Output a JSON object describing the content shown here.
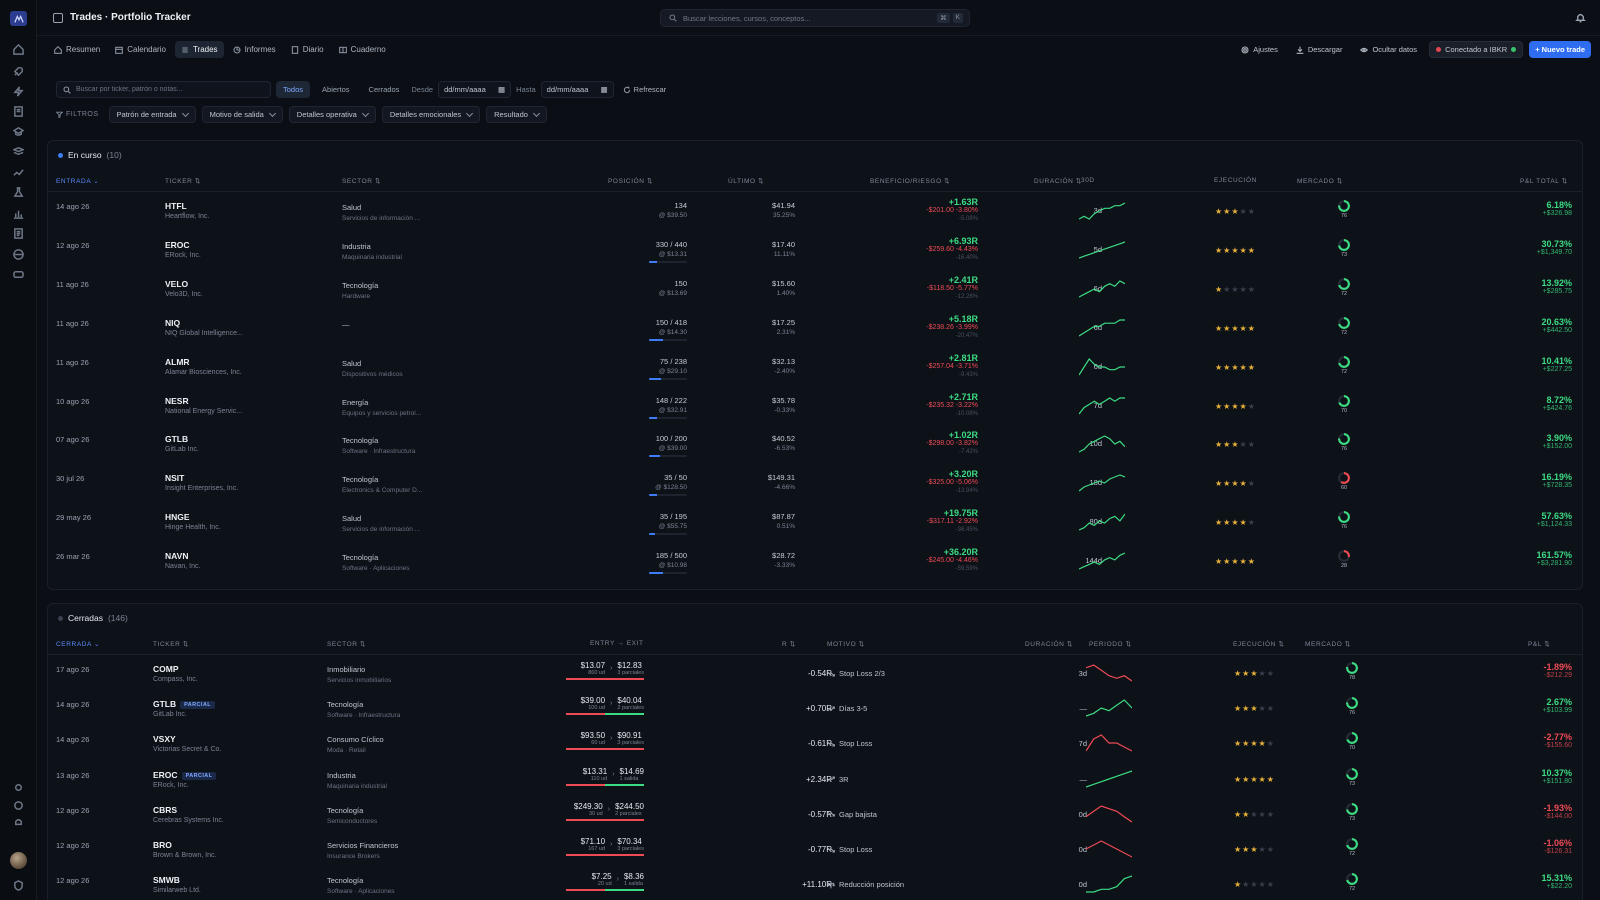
{
  "app": {
    "title": "Trades · Portfolio Tracker"
  },
  "search": {
    "placeholder": "Buscar lecciones, cursos, conceptos...",
    "k1": "⌘",
    "k2": "K"
  },
  "tabs": [
    {
      "label": "Resumen",
      "icon": "home-icon"
    },
    {
      "label": "Calendario",
      "icon": "calendar-icon"
    },
    {
      "label": "Trades",
      "icon": "list-icon",
      "active": true
    },
    {
      "label": "Informes",
      "icon": "chart-icon"
    },
    {
      "label": "Diario",
      "icon": "book-icon"
    },
    {
      "label": "Cuaderno",
      "icon": "notebook-icon"
    }
  ],
  "actions": {
    "ajustes": "Ajustes",
    "descargar": "Descargar",
    "ocultar": "Ocultar datos",
    "ibkr": "Conectado a IBKR",
    "nuevo": "+ Nuevo trade"
  },
  "filters": {
    "search_placeholder": "Buscar por ticker, patrón o notas...",
    "segments": [
      "Todos",
      "Abiertos",
      "Cerrados"
    ],
    "desde": "Desde",
    "hasta": "Hasta",
    "date_placeholder": "dd/mm/aaaa",
    "refresh": "Refrescar",
    "filtros": "FILTROS",
    "dropdowns": [
      "Patrón de entrada",
      "Motivo de salida",
      "Detalles operativa",
      "Detalles emocionales",
      "Resultado"
    ]
  },
  "open": {
    "title": "En curso",
    "count": "(10)",
    "headers": {
      "entrada": "ENTRADA",
      "ticker": "TICKER",
      "sector": "SECTOR",
      "posicion": "POSICIÓN",
      "ultimo": "ÚLTIMO",
      "br": "BENEFICIO/RIESGO",
      "duracion": "DURACIÓN",
      "d30": "30D",
      "ejecucion": "EJECUCIÓN",
      "mercado": "MERCADO",
      "pnl": "P&L TOTAL"
    },
    "rows": [
      {
        "date": "14 ago 26",
        "ticker": "HTFL",
        "name": "Heartflow, Inc.",
        "sector": "Salud",
        "industry": "Servicios de información ...",
        "pos": "134",
        "avg": "@ $39.50",
        "fill": 0,
        "last": "$41.94",
        "chg": "35.25%",
        "r": "+1.63R",
        "risk": "-$201.00 -3.80%",
        "risk2": "-5.08%",
        "dur": "3d",
        "spark": [
          5,
          6,
          5,
          7,
          8,
          9,
          9,
          10,
          10,
          11
        ],
        "stars": 3,
        "mkt": 76,
        "mkt_color": "#3ddc84",
        "pnl": "6.18%",
        "pnl2": "+$326.98"
      },
      {
        "date": "12 ago 26",
        "ticker": "EROC",
        "name": "ERock, Inc.",
        "sector": "Industria",
        "industry": "Maquinaria industrial",
        "pos": "330 / 440",
        "avg": "@ $13.31",
        "fill": 0.2,
        "last": "$17.40",
        "chg": "11.11%",
        "r": "+6.93R",
        "risk": "-$259.60 -4.43%",
        "risk2": "-16.40%",
        "dur": "5d",
        "spark": [
          2,
          3,
          4,
          5,
          6,
          7,
          8,
          9,
          10,
          11
        ],
        "stars": 5,
        "mkt": 73,
        "mkt_color": "#3ddc84",
        "pnl": "30.73%",
        "pnl2": "+$1,349.70"
      },
      {
        "date": "11 ago 26",
        "ticker": "VELO",
        "name": "Velo3D, Inc.",
        "sector": "Tecnología",
        "industry": "Hardware",
        "pos": "150",
        "avg": "@ $13.69",
        "fill": 0,
        "last": "$15.60",
        "chg": "1.40%",
        "r": "+2.41R",
        "risk": "-$118.50 -5.77%",
        "risk2": "-12.28%",
        "dur": "6d",
        "spark": [
          4,
          5,
          6,
          7,
          6,
          8,
          9,
          8,
          10,
          9
        ],
        "stars": 1,
        "mkt": 72,
        "mkt_color": "#3ddc84",
        "pnl": "13.92%",
        "pnl2": "+$285.75"
      },
      {
        "date": "11 ago 26",
        "ticker": "NIQ",
        "name": "NIQ Global Intelligence...",
        "sector": "—",
        "industry": "",
        "pos": "150 / 418",
        "avg": "@ $14.30",
        "fill": 0.36,
        "last": "$17.25",
        "chg": "2.31%",
        "r": "+5.18R",
        "risk": "-$238.26 -3.99%",
        "risk2": "-20.47%",
        "dur": "6d",
        "spark": [
          4,
          5,
          6,
          7,
          7,
          8,
          8,
          8,
          9,
          9
        ],
        "stars": 5,
        "mkt": 72,
        "mkt_color": "#3ddc84",
        "pnl": "20.63%",
        "pnl2": "+$442.50"
      },
      {
        "date": "11 ago 26",
        "ticker": "ALMR",
        "name": "Alamar Biosciences, Inc.",
        "sector": "Salud",
        "industry": "Dispositivos médicos",
        "pos": "75 / 238",
        "avg": "@ $29.10",
        "fill": 0.32,
        "last": "$32.13",
        "chg": "-2.40%",
        "r": "+2.81R",
        "risk": "-$257.04 -3.71%",
        "risk2": "-9.43%",
        "dur": "6d",
        "spark": [
          3,
          6,
          9,
          7,
          6,
          6,
          5,
          5,
          6,
          6
        ],
        "stars": 5,
        "mkt": 72,
        "mkt_color": "#3ddc84",
        "pnl": "10.41%",
        "pnl2": "+$227.25"
      },
      {
        "date": "10 ago 26",
        "ticker": "NESR",
        "name": "National Energy Servic...",
        "sector": "Energía",
        "industry": "Equipos y servicios petrol...",
        "pos": "148 / 222",
        "avg": "@ $32.91",
        "fill": 0.2,
        "last": "$35.78",
        "chg": "-0.33%",
        "r": "+2.71R",
        "risk": "-$235.32 -3.22%",
        "risk2": "-10.08%",
        "dur": "7d",
        "spark": [
          4,
          6,
          7,
          8,
          7,
          8,
          9,
          8,
          9,
          9
        ],
        "stars": 4,
        "mkt": 70,
        "mkt_color": "#3ddc84",
        "pnl": "8.72%",
        "pnl2": "+$424.76"
      },
      {
        "date": "07 ago 26",
        "ticker": "GTLB",
        "name": "GitLab Inc.",
        "sector": "Tecnología",
        "industry": "Software · Infraestructura",
        "pos": "100 / 200",
        "avg": "@ $39.00",
        "fill": 0.3,
        "last": "$40.52",
        "chg": "-6.53%",
        "r": "+1.02R",
        "risk": "-$298.00 -3.82%",
        "risk2": "-7.42%",
        "dur": "10d",
        "spark": [
          3,
          4,
          6,
          7,
          8,
          9,
          8,
          6,
          7,
          5
        ],
        "stars": 3,
        "mkt": 76,
        "mkt_color": "#3ddc84",
        "pnl": "3.90%",
        "pnl2": "+$152.00"
      },
      {
        "date": "30 jul 26",
        "ticker": "NSIT",
        "name": "Insight Enterprises, Inc.",
        "sector": "Tecnología",
        "industry": "Electronics & Computer D...",
        "pos": "35 / 50",
        "avg": "@ $128.50",
        "fill": 0.22,
        "last": "$149.31",
        "chg": "-4.66%",
        "r": "+3.20R",
        "risk": "-$325.00 -5.06%",
        "risk2": "-13.94%",
        "dur": "18d",
        "spark": [
          3,
          5,
          6,
          7,
          8,
          7,
          9,
          10,
          11,
          10
        ],
        "stars": 4,
        "mkt": 60,
        "mkt_color": "#ef4b55",
        "pnl": "16.19%",
        "pnl2": "+$728.35"
      },
      {
        "date": "29 may 26",
        "ticker": "HNGE",
        "name": "Hinge Health, Inc.",
        "sector": "Salud",
        "industry": "Servicios de información ...",
        "pos": "35 / 195",
        "avg": "@ $55.75",
        "fill": 0.15,
        "last": "$87.87",
        "chg": "0.51%",
        "r": "+19.75R",
        "risk": "-$317.11 -2.92%",
        "risk2": "-36.45%",
        "dur": "80d",
        "spark": [
          3,
          4,
          6,
          5,
          7,
          6,
          8,
          9,
          7,
          10
        ],
        "stars": 4,
        "mkt": 76,
        "mkt_color": "#3ddc84",
        "pnl": "57.63%",
        "pnl2": "+$1,124.33"
      },
      {
        "date": "26 mar 26",
        "ticker": "NAVN",
        "name": "Navan, Inc.",
        "sector": "Tecnología",
        "industry": "Software · Aplicaciones",
        "pos": "185 / 500",
        "avg": "@ $10.98",
        "fill": 0.37,
        "last": "$28.72",
        "chg": "-3.33%",
        "r": "+36.20R",
        "risk": "-$245.00 -4.46%",
        "risk2": "-59.59%",
        "dur": "144d",
        "spark": [
          3,
          4,
          5,
          6,
          5,
          7,
          8,
          7,
          9,
          10
        ],
        "stars": 5,
        "mkt": 28,
        "mkt_color": "#ef4b55",
        "pnl": "161.57%",
        "pnl2": "+$3,281.90"
      }
    ]
  },
  "closed": {
    "title": "Cerradas",
    "count": "(146)",
    "headers": {
      "cerrada": "CERRADA",
      "ticker": "TICKER",
      "sector": "SECTOR",
      "ee": "ENTRY → EXIT",
      "r": "R",
      "motivo": "MOTIVO",
      "duracion": "DURACIÓN",
      "periodo": "PERIODO",
      "ejecucion": "EJECUCIÓN",
      "mercado": "MERCADO",
      "pnl": "P&L"
    },
    "rows": [
      {
        "date": "17 ago 26",
        "ticker": "COMP",
        "tag": "",
        "name": "Compass, Inc.",
        "sector": "Inmobiliario",
        "industry": "Servicios inmobiliarios",
        "entry": "$13.07",
        "entry_u": "860 ud",
        "exit": "$12.83",
        "exit_u": "3 parciales",
        "win": false,
        "r": "-0.54R",
        "motivo": "Stop Loss 2/3",
        "motivo_icon": "trend-down-icon",
        "dur": "3d",
        "spark": [
          8,
          9,
          7,
          5,
          4,
          5,
          3
        ],
        "stars": 3,
        "mkt": 78,
        "mkt_color": "#3ddc84",
        "pnl": "-1.89%",
        "pnl2": "-$212.29"
      },
      {
        "date": "14 ago 26",
        "ticker": "GTLB",
        "tag": "PARCIAL",
        "name": "GitLab Inc.",
        "sector": "Tecnología",
        "industry": "Software · Infraestructura",
        "entry": "$39.00",
        "entry_u": "100 ud",
        "exit": "$40.04",
        "exit_u": "2 parciales",
        "win": true,
        "r": "+0.70R",
        "motivo": "Días 3-5",
        "motivo_icon": "trend-up-icon",
        "dur": "—",
        "spark": [
          3,
          4,
          6,
          5,
          7,
          9,
          6
        ],
        "stars": 3,
        "mkt": 76,
        "mkt_color": "#3ddc84",
        "pnl": "2.67%",
        "pnl2": "+$103.99"
      },
      {
        "date": "14 ago 26",
        "ticker": "VSXY",
        "tag": "",
        "name": "Victorias Secret & Co.",
        "sector": "Consumo Cíclico",
        "industry": "Moda · Retail",
        "entry": "$93.50",
        "entry_u": "60 ud",
        "exit": "$90.91",
        "exit_u": "3 parciales",
        "win": false,
        "r": "-0.61R",
        "motivo": "Stop Loss",
        "motivo_icon": "trend-down-icon",
        "dur": "7d",
        "spark": [
          4,
          7,
          8,
          6,
          6,
          5,
          4
        ],
        "stars": 4,
        "mkt": 70,
        "mkt_color": "#3ddc84",
        "pnl": "-2.77%",
        "pnl2": "-$155.60"
      },
      {
        "date": "13 ago 26",
        "ticker": "EROC",
        "tag": "PARCIAL",
        "name": "ERock, Inc.",
        "sector": "Industria",
        "industry": "Maquinaria industrial",
        "entry": "$13.31",
        "entry_u": "110 ud",
        "exit": "$14.69",
        "exit_u": "1 salida",
        "win": true,
        "r": "+2.34R",
        "motivo": "3R",
        "motivo_icon": "trend-up-icon",
        "dur": "—",
        "spark": [
          3,
          4,
          5,
          6,
          7,
          8,
          9
        ],
        "stars": 5,
        "mkt": 73,
        "mkt_color": "#3ddc84",
        "pnl": "10.37%",
        "pnl2": "+$151.80"
      },
      {
        "date": "12 ago 26",
        "ticker": "CBRS",
        "tag": "",
        "name": "Cerebras Systems Inc.",
        "sector": "Tecnología",
        "industry": "Semiconductores",
        "entry": "$249.30",
        "entry_u": "30 ud",
        "exit": "$244.50",
        "exit_u": "2 parciales",
        "win": false,
        "r": "-0.57R",
        "motivo": "Gap bajista",
        "motivo_icon": "trend-down-icon",
        "dur": "0d",
        "spark": [
          4,
          6,
          8,
          7,
          6,
          4,
          2
        ],
        "stars": 2,
        "mkt": 73,
        "mkt_color": "#3ddc84",
        "pnl": "-1.93%",
        "pnl2": "-$144.00"
      },
      {
        "date": "12 ago 26",
        "ticker": "BRO",
        "tag": "",
        "name": "Brown & Brown, Inc.",
        "sector": "Servicios Financieros",
        "industry": "Insurance Brokers",
        "entry": "$71.10",
        "entry_u": "167 ud",
        "exit": "$70.34",
        "exit_u": "3 parciales",
        "win": false,
        "r": "-0.77R",
        "motivo": "Stop Loss",
        "motivo_icon": "trend-down-icon",
        "dur": "0d",
        "spark": [
          6,
          7,
          8,
          7,
          6,
          5,
          4
        ],
        "stars": 3,
        "mkt": 72,
        "mkt_color": "#3ddc84",
        "pnl": "-1.06%",
        "pnl2": "-$126.31"
      },
      {
        "date": "12 ago 26",
        "ticker": "SMWB",
        "tag": "",
        "name": "Similarweb Ltd.",
        "sector": "Tecnología",
        "industry": "Software · Aplicaciones",
        "entry": "$7.25",
        "entry_u": "20 ud",
        "exit": "$8.36",
        "exit_u": "1 salida",
        "win": true,
        "r": "+11.10R",
        "motivo": "Reducción posición",
        "motivo_icon": "scale-icon",
        "dur": "0d",
        "spark": [
          3,
          3,
          4,
          4,
          5,
          8,
          9
        ],
        "stars": 1,
        "mkt": 72,
        "mkt_color": "#3ddc84",
        "pnl": "15.31%",
        "pnl2": "+$22.20"
      }
    ]
  },
  "colors": {
    "accent": "#2f6df0",
    "green": "#3ddc84",
    "red": "#ef4b55",
    "star": "#e8b23a"
  }
}
